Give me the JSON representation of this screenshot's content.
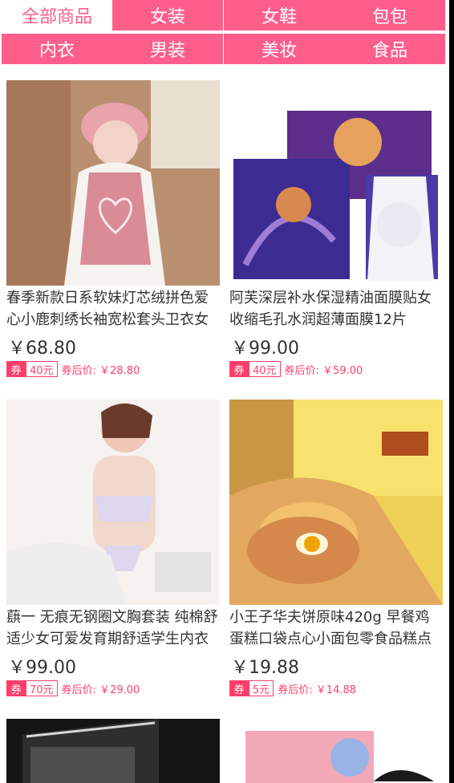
{
  "tabs": [
    "全部商品",
    "女装",
    "女鞋",
    "包包",
    "内衣",
    "男装",
    "美妆",
    "食品"
  ],
  "products": [
    {
      "title": "春季新款日系软妹灯芯绒拼色爱心小鹿刺绣长袖宽松套头卫衣女",
      "price": "￥68.80",
      "coupon": "40元",
      "after_price": "券后价: ￥28.80",
      "image": "pink-sweater-photo"
    },
    {
      "title": "阿芙深层补水保湿精油面膜贴女收缩毛孔水润超薄面膜12片",
      "price": "￥99.00",
      "coupon": "40元",
      "after_price": "券后价: ￥59.00",
      "image": "face-mask-box-photo"
    },
    {
      "title": "蕻一 无痕无钢圈文胸套装 纯棉舒适少女可爱发育期舒适学生内衣",
      "price": "￥99.00",
      "coupon": "70元",
      "after_price": "券后价: ￥29.00",
      "image": "lingerie-photo"
    },
    {
      "title": "小王子华夫饼原味420g 早餐鸡蛋糕口袋点心小面包零食品糕点",
      "price": "￥19.88",
      "coupon": "5元",
      "after_price": "券后价: ￥14.88",
      "image": "waffle-snack-photo"
    }
  ],
  "coupon_label": "券",
  "colors": {
    "accent": "#ff5e8b",
    "coupon": "#ff3f6b",
    "background": "#ffffff"
  }
}
